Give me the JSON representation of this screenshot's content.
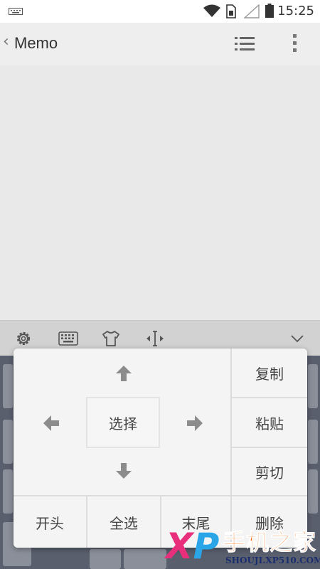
{
  "statusbar": {
    "time": "15:25",
    "icons": [
      "keyboard-indicator-icon",
      "wifi-icon",
      "sim-card-icon",
      "signal-icon",
      "battery-icon"
    ]
  },
  "appbar": {
    "back_glyph": "‹",
    "title": "Memo",
    "icons": [
      "list-icon",
      "more-vert-icon"
    ]
  },
  "keyboard_toolbar": {
    "icons": [
      "gear-icon",
      "keyboard-icon",
      "tshirt-theme-icon",
      "cursor-move-icon",
      "chevron-down-icon"
    ]
  },
  "edit_panel": {
    "select": "选择",
    "copy": "复制",
    "paste": "粘贴",
    "cut": "剪切",
    "delete": "删除",
    "start": "开头",
    "select_all": "全选",
    "end": "末尾",
    "arrow_color": "#8c8c8c"
  },
  "watermark": {
    "brand_x": "X",
    "brand_p": "P",
    "brand_cn": "手机之家",
    "url": "SHOUJI.XP510.COM"
  }
}
